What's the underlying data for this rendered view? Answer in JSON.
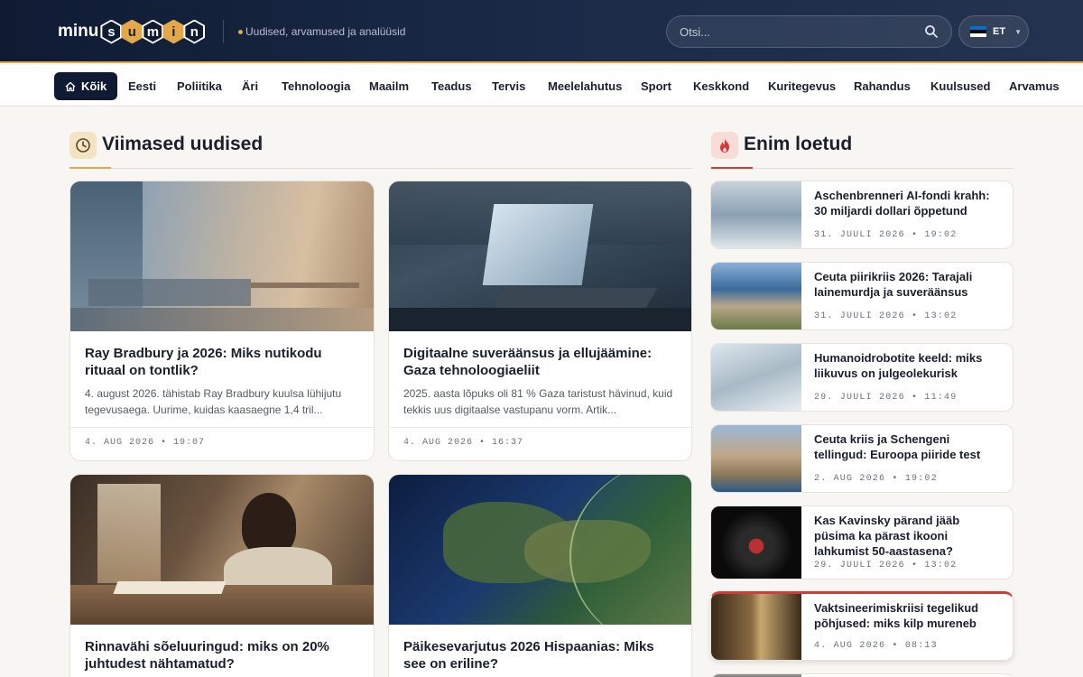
{
  "brand": {
    "prefix": "minu",
    "hex_letters": [
      "s",
      "u",
      "m",
      "i",
      "n"
    ],
    "tagline": "Uudised, arvamused ja analüüsid"
  },
  "search": {
    "placeholder": "Otsi..."
  },
  "language": {
    "code": "ET"
  },
  "nav": {
    "items": [
      "Kõik",
      "Eesti",
      "Poliitika",
      "Äri",
      "Tehnoloogia",
      "Maailm",
      "Teadus",
      "Tervis",
      "Meelelahutus",
      "Sport",
      "Keskkond",
      "Kuritegevus",
      "Rahandus",
      "Kuulsused",
      "Arvamus"
    ],
    "active": "Kõik"
  },
  "latest": {
    "title": "Viimased uudised",
    "articles": [
      {
        "title": "Ray Bradbury ja 2026: Miks nutikodu rituaal on tontlik?",
        "excerpt": "4. august 2026. tähistab Ray Bradbury kuulsa lühijutu tegevusaega. Uurime, kuidas kaasaegne 1,4 tril...",
        "date": "4. AUG 2026 • 19:07"
      },
      {
        "title": "Digitaalne suveräänsus ja ellujäämine: Gaza tehnoloogiaeliit",
        "excerpt": "2025. aasta lõpuks oli 81 % Gaza taristust hävinud, kuid tekkis uus digitaalse vastupanu vorm. Artik...",
        "date": "4. AUG 2026 • 16:37"
      },
      {
        "title": "Rinnavähi sõeluuringud: miks on 20% juhtudest nähtamatud?",
        "excerpt": "",
        "date": ""
      },
      {
        "title": "Päikesevarjutus 2026 Hispaanias: Miks see on eriline?",
        "excerpt": "",
        "date": ""
      }
    ]
  },
  "popular": {
    "title": "Enim loetud",
    "items": [
      {
        "title": "Aschenbrenneri AI-fondi krahh: 30 miljardi dollari õppetund",
        "date": "31. JUULI 2026 • 19:02"
      },
      {
        "title": "Ceuta piirikriis 2026: Tarajali lainemurdja ja suveräänsus",
        "date": "31. JUULI 2026 • 13:02"
      },
      {
        "title": "Humanoidrobotite keeld: miks liikuvus on julgeolekurisk",
        "date": "29. JUULI 2026 • 11:49"
      },
      {
        "title": "Ceuta kriis ja Schengeni tellingud: Euroopa piiride test",
        "date": "2. AUG 2026 • 19:02"
      },
      {
        "title": "Kas Kavinsky pärand jääb püsima ka pärast ikooni lahkumist 50-aastasena?",
        "date": "29. JUULI 2026 • 13:02"
      },
      {
        "title": "Vaktsineerimiskriisi tegelikud põhjused: miks kilp mureneb",
        "date": "4. AUG 2026 • 08:13"
      }
    ]
  },
  "colors": {
    "accent": "#e2a84a",
    "navy": "#0f1b33",
    "hot": "#d43a3a"
  }
}
